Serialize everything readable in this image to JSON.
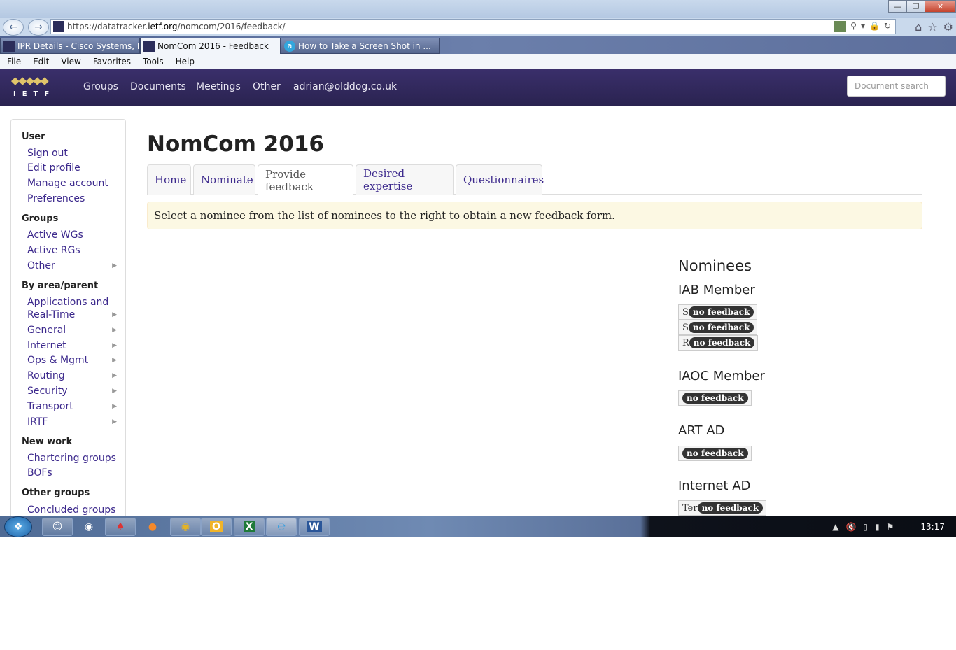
{
  "browser": {
    "url_prefix": "https://datatracker.",
    "url_domain": "ietf.org",
    "url_path": "/nomcom/2016/feedback/",
    "tabs": [
      {
        "label": "IPR Details - Cisco Systems, Inc...."
      },
      {
        "label": "NomCom 2016 - Feedback"
      },
      {
        "label": "How to Take a Screen Shot in ..."
      }
    ],
    "menu": [
      "File",
      "Edit",
      "View",
      "Favorites",
      "Tools",
      "Help"
    ]
  },
  "header": {
    "logo_text": "IETF",
    "links": [
      "Groups",
      "Documents",
      "Meetings",
      "Other",
      "adrian@olddog.co.uk"
    ],
    "search_placeholder": "Document search"
  },
  "sidebar": {
    "user": {
      "heading": "User",
      "items": [
        "Sign out",
        "Edit profile",
        "Manage account",
        "Preferences"
      ]
    },
    "groups": {
      "heading": "Groups",
      "items": [
        "Active WGs",
        "Active RGs",
        "Other"
      ]
    },
    "area": {
      "heading": "By area/parent",
      "items": [
        "Applications and",
        "Real-Time",
        "General",
        "Internet",
        "Ops & Mgmt",
        "Routing",
        "Security",
        "Transport",
        "IRTF"
      ]
    },
    "new_work": {
      "heading": "New work",
      "items": [
        "Chartering groups",
        "BOFs"
      ]
    },
    "other_groups": {
      "heading": "Other groups",
      "items": [
        "Concluded groups"
      ]
    }
  },
  "main": {
    "title": "NomCom 2016",
    "tabs": [
      "Home",
      "Nominate",
      "Provide feedback",
      "Desired expertise",
      "Questionnaires"
    ],
    "active_tab": "Provide feedback",
    "alert": "Select a nominee from the list of nominees to the right to obtain a new feedback form.",
    "nominees_heading": "Nominees",
    "positions": [
      {
        "title": "IAB Member",
        "nominees": [
          {
            "name": "S",
            "badge": "no feedback"
          },
          {
            "name": "S",
            "badge": "no feedback"
          },
          {
            "name": "R",
            "badge": "no feedback"
          }
        ]
      },
      {
        "title": "IAOC Member",
        "nominees": [
          {
            "name": "",
            "badge": "no feedback"
          }
        ]
      },
      {
        "title": "ART AD",
        "nominees": [
          {
            "name": "",
            "badge": "no feedback"
          }
        ]
      },
      {
        "title": "Internet AD",
        "nominees": [
          {
            "name": "Ter",
            "badge": "no feedback"
          }
        ]
      }
    ]
  },
  "taskbar": {
    "clock": "13:17",
    "apps": [
      "ie-app",
      "excel-app",
      "internet-explorer",
      "word-app"
    ],
    "excel_letter": "X",
    "word_letter": "W",
    "outlook_letter": "O"
  }
}
